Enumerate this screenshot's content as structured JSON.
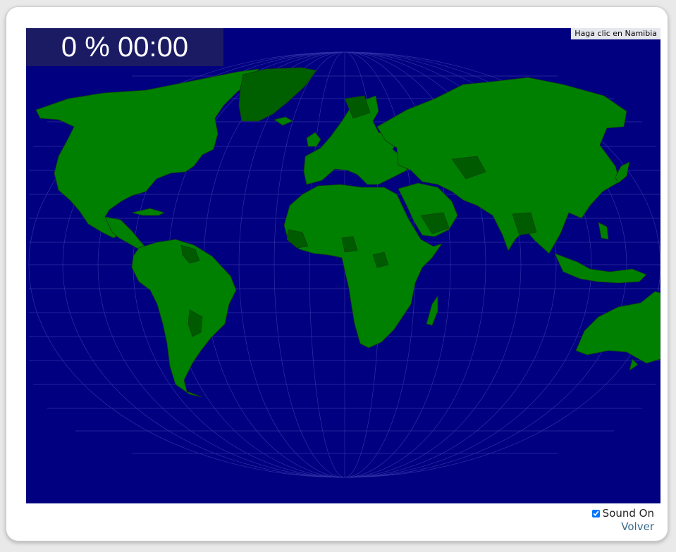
{
  "hud": {
    "score_time": "0 % 00:00"
  },
  "prompt": {
    "text": "Haga clic en Namibia"
  },
  "controls": {
    "sound_label": "Sound On",
    "sound_checked": true,
    "back_label": "Volver"
  },
  "map": {
    "ocean_color": "#000080",
    "land_color": "#008000",
    "land_dark_color": "#006000",
    "grid_color": "#4a4ab8",
    "border_color": "#1a3a1a"
  }
}
